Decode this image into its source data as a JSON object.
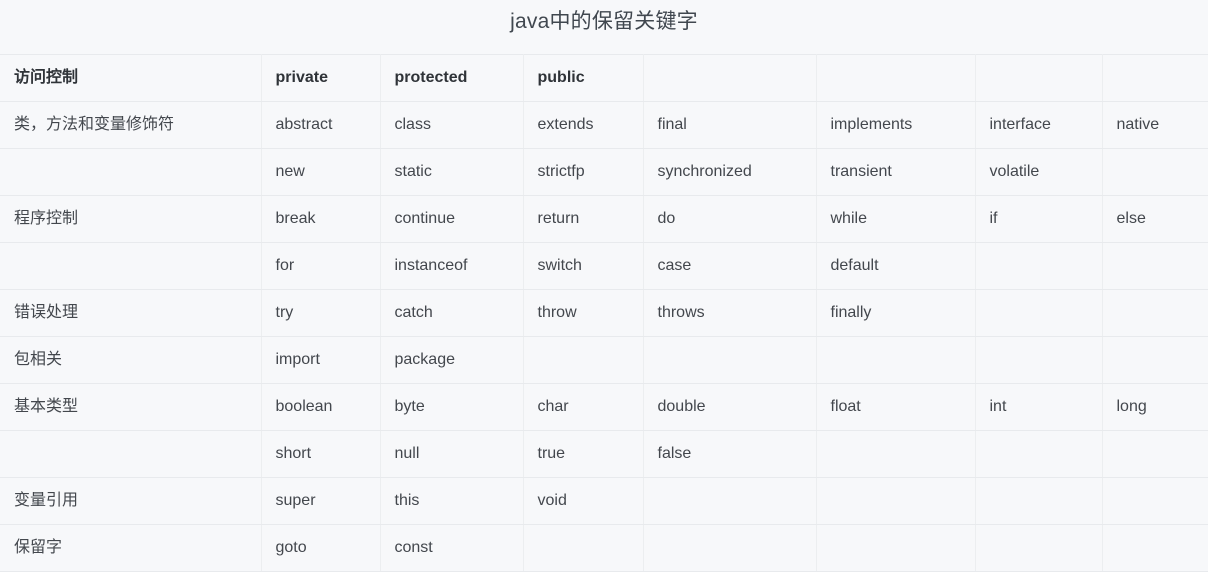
{
  "document": {
    "title": "java中的保留关键字"
  },
  "theme": {
    "background": "#f7f8fa",
    "text": "#43474d",
    "header_text": "#2f3338",
    "border": "#e8eaed",
    "title_text": "#40474f"
  },
  "table": {
    "columns": 8,
    "headers": [
      "访问控制",
      "private",
      "protected",
      "public",
      "",
      "",
      "",
      ""
    ],
    "rows": [
      [
        "类，方法和变量修饰符",
        "abstract",
        "class",
        "extends",
        "final",
        "implements",
        "interface",
        "native"
      ],
      [
        "",
        "new",
        "static",
        "strictfp",
        "synchronized",
        "transient",
        "volatile",
        ""
      ],
      [
        "程序控制",
        "break",
        "continue",
        "return",
        "do",
        "while",
        "if",
        "else"
      ],
      [
        "",
        "for",
        "instanceof",
        "switch",
        "case",
        "default",
        "",
        ""
      ],
      [
        "错误处理",
        "try",
        "catch",
        "throw",
        "throws",
        "finally",
        "",
        ""
      ],
      [
        "包相关",
        "import",
        "package",
        "",
        "",
        "",
        "",
        ""
      ],
      [
        "基本类型",
        "boolean",
        "byte",
        "char",
        "double",
        "float",
        "int",
        "long"
      ],
      [
        "",
        "short",
        "null",
        "true",
        "false",
        "",
        "",
        ""
      ],
      [
        "变量引用",
        "super",
        "this",
        "void",
        "",
        "",
        "",
        ""
      ],
      [
        "保留字",
        "goto",
        "const",
        "",
        "",
        "",
        "",
        ""
      ]
    ]
  }
}
